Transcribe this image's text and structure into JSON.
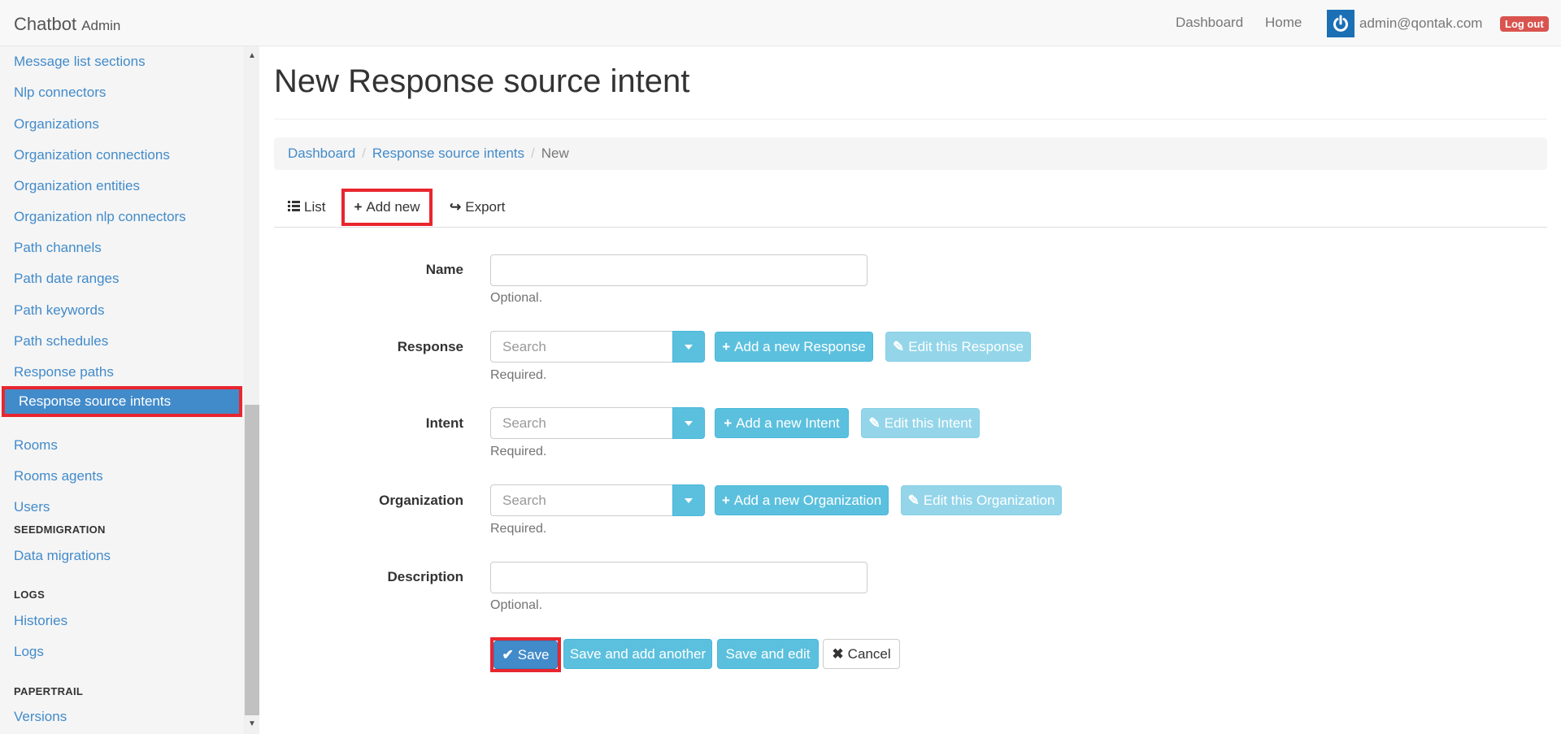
{
  "navbar": {
    "brand": "Chatbot",
    "brand_suffix": "Admin",
    "links": [
      "Dashboard",
      "Home"
    ],
    "user_email": "admin@qontak.com",
    "logout_label": "Log out"
  },
  "sidebar": {
    "items": [
      {
        "label": "Message list sections"
      },
      {
        "label": "Nlp connectors"
      },
      {
        "label": "Organizations"
      },
      {
        "label": "Organization connections"
      },
      {
        "label": "Organization entities"
      },
      {
        "label": "Organization nlp connectors"
      },
      {
        "label": "Path channels"
      },
      {
        "label": "Path date ranges"
      },
      {
        "label": "Path keywords"
      },
      {
        "label": "Path schedules"
      },
      {
        "label": "Response paths"
      },
      {
        "label": "Response source intents",
        "active": true
      },
      {
        "label": "Rooms"
      },
      {
        "label": "Rooms agents"
      },
      {
        "label": "Users"
      }
    ],
    "sections": [
      {
        "header": "SEEDMIGRATION",
        "items": [
          "Data migrations"
        ]
      },
      {
        "header": "LOGS",
        "items": [
          "Histories",
          "Logs"
        ]
      },
      {
        "header": "PAPERTRAIL",
        "items": [
          "Versions"
        ]
      }
    ]
  },
  "page": {
    "title": "New Response source intent",
    "breadcrumb": [
      "Dashboard",
      "Response source intents",
      "New"
    ],
    "tabs": [
      "List",
      "Add new",
      "Export"
    ]
  },
  "form": {
    "name": {
      "label": "Name",
      "help": "Optional."
    },
    "response": {
      "label": "Response",
      "placeholder": "Search",
      "add_label": "Add a new Response",
      "edit_label": "Edit this Response",
      "help": "Required."
    },
    "intent": {
      "label": "Intent",
      "placeholder": "Search",
      "add_label": "Add a new Intent",
      "edit_label": "Edit this Intent",
      "help": "Required."
    },
    "organization": {
      "label": "Organization",
      "placeholder": "Search",
      "add_label": "Add a new Organization",
      "edit_label": "Edit this Organization",
      "help": "Required."
    },
    "description": {
      "label": "Description",
      "help": "Optional."
    }
  },
  "actions": {
    "save": "Save",
    "save_add": "Save and add another",
    "save_edit": "Save and edit",
    "cancel": "Cancel"
  },
  "colors": {
    "primary": "#428bca",
    "info": "#5bc0de",
    "danger": "#d9534f",
    "highlight": "#e8262f"
  }
}
